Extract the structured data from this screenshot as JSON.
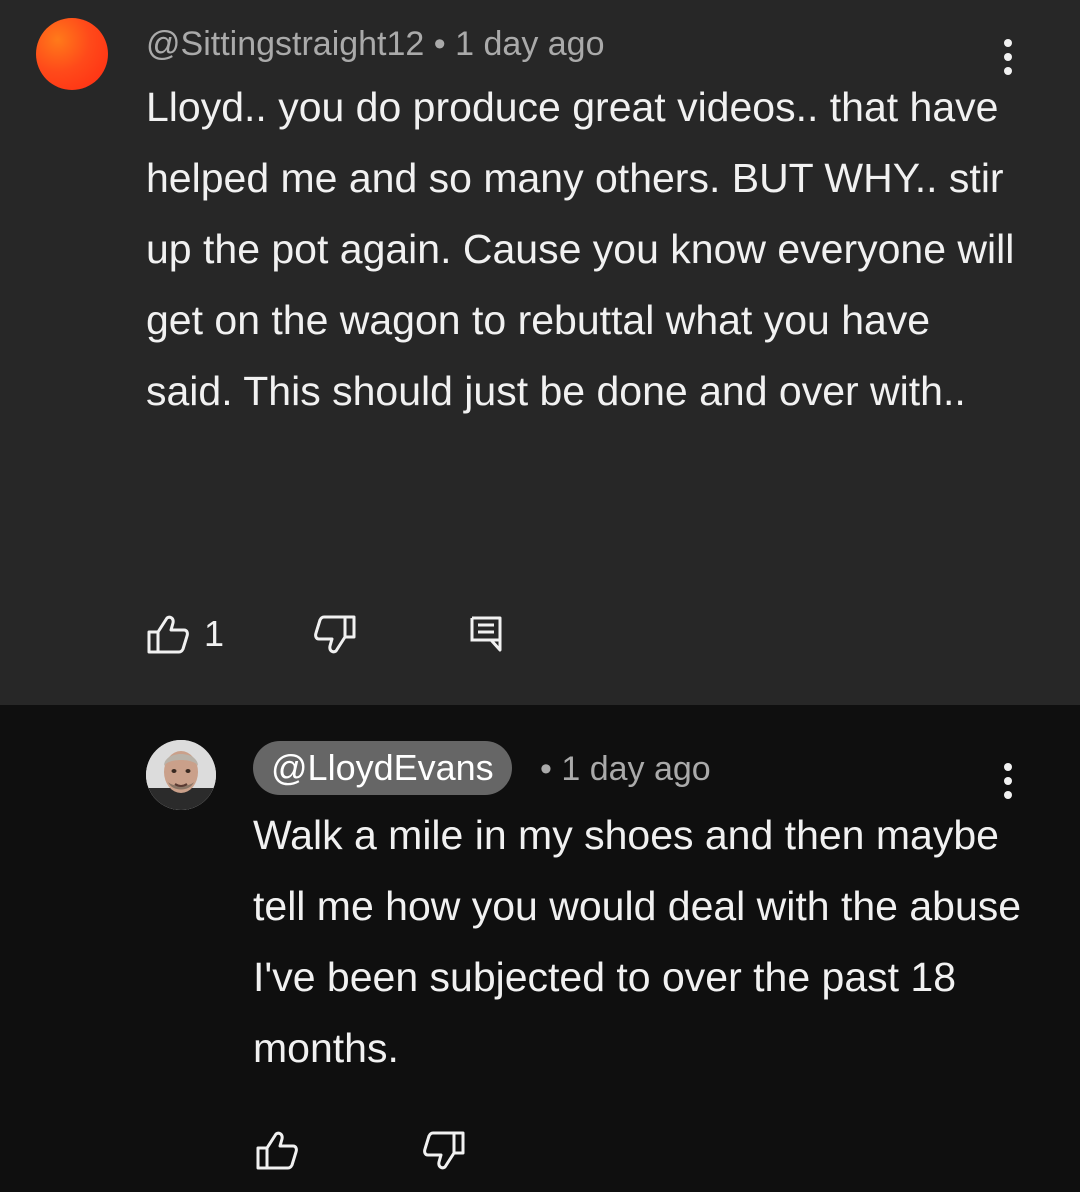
{
  "comment": {
    "handle": "@Sittingstraight12",
    "separator": "•",
    "time": "1 day ago",
    "text": "Lloyd.. you do produce great videos.. that have helped me and so many others. BUT WHY.. stir up the pot again. Cause you know everyone will get on the wagon to rebuttal what you have said. This should just be done and over with..",
    "likes": "1",
    "avatar_color": "#ff4a1a",
    "icons": [
      "thumbs-up-icon",
      "thumbs-down-icon",
      "reply-icon",
      "more-vert-icon"
    ]
  },
  "reply": {
    "handle": "@LloydEvans",
    "separator": "•",
    "time": "1 day ago",
    "text": "Walk a mile in my shoes and then maybe tell me how you would deal with the abuse I've been subjected to over the past 18 months.",
    "icons": [
      "thumbs-up-icon",
      "thumbs-down-icon",
      "more-vert-icon"
    ]
  },
  "colors": {
    "top_bg": "#272727",
    "reply_bg": "#0f0f0f",
    "text": "#f1f1f1",
    "meta": "#aaaaaa",
    "pill": "#666666"
  }
}
